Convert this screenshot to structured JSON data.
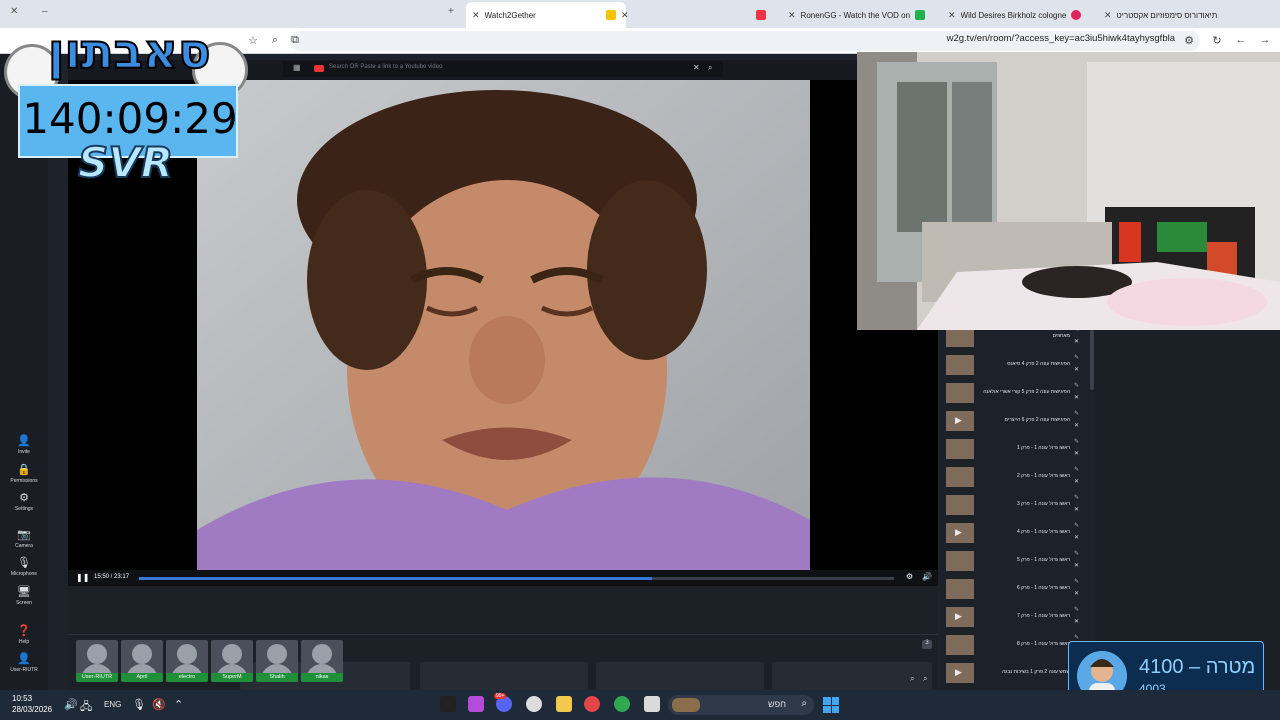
{
  "browser": {
    "tabs": [
      {
        "title": "Watch2Gether",
        "active": true
      },
      {
        "title": "RonenGG - Watch the VOD on"
      },
      {
        "title": "Wild Desires Birkholz cologne"
      },
      {
        "title": "תיאודורוס סימפוזיום אקסטריט"
      }
    ],
    "url": "w2g.tv/en/room/?access_key=ac3iu5hiwk4tayhysgfbla"
  },
  "sidebar": {
    "invite": "Invite",
    "permissions": "Permissions",
    "settings": "Settings",
    "camera": "Camera",
    "microphone": "Microphone",
    "screen": "Screen",
    "help": "Help",
    "user": "User-RIUTR"
  },
  "player": {
    "search_placeholder": "Search OR Paste a link to a Youtube video",
    "time": "15:50 / 23:17",
    "progress": 0.68
  },
  "users": [
    {
      "name": "User-RIUTR"
    },
    {
      "name": "April"
    },
    {
      "name": "electro"
    },
    {
      "name": "SuperM"
    },
    {
      "name": "Shalih"
    },
    {
      "name": "nikas"
    }
  ],
  "user_count": "3",
  "playlist": [
    {
      "title": "מאחוזים",
      "play": false
    },
    {
      "title": "הפיגישות עונה 2 פרק 4 סיאנס",
      "play": false
    },
    {
      "title": "הפיגישות עונה 2 פרק 5 קורי אשרי אולאנה",
      "play": false
    },
    {
      "title": "הפיגישות עונה 2 פרק 6 הייצרים",
      "play": true
    },
    {
      "title": "ראשו גדול עונה 1 - פרק 1",
      "play": false
    },
    {
      "title": "ראשו גדול עונה 1 - פרק 2",
      "play": false
    },
    {
      "title": "ראשו גדול עונה 1 - פרק 3",
      "play": false
    },
    {
      "title": "ראשו גדול עונה 1 - פרק 4",
      "play": true
    },
    {
      "title": "ראשו גדול עונה 1 - פרק 5",
      "play": false
    },
    {
      "title": "ראשו גדול עונה 1 - פרק 6",
      "play": false
    },
    {
      "title": "ראשו גדול עונה 1 - פרק 7",
      "play": true
    },
    {
      "title": "ראשו גדול עונה 1 - פרק 8",
      "play": false
    },
    {
      "title": "שמש עונה 2 פרק 1 בשיכות נבגה",
      "play": true
    }
  ],
  "overlay": {
    "logo": "סאבתון",
    "timer": "140:09:29",
    "label": "SVR"
  },
  "goal": {
    "title": "מטרה – 4100",
    "current": "4003"
  },
  "taskbar": {
    "time": "10:53",
    "date": "28/03/2026",
    "lang": "ENG",
    "search": "חפש",
    "notif_count": "99+"
  },
  "colors": {
    "progress": "#3a78d6",
    "user_tag": "#1f8f3a",
    "goal_border": "#6fb5ff"
  }
}
